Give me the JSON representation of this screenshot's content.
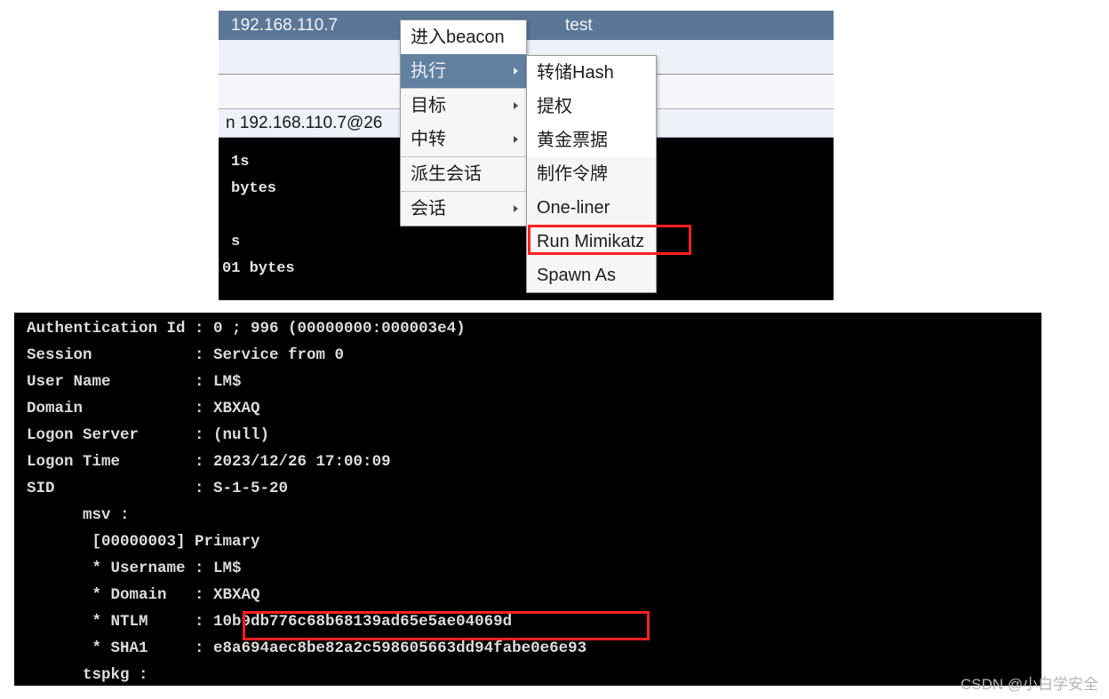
{
  "cs_panel": {
    "table_header": {
      "host": "192.168.110.7",
      "note": "test"
    },
    "console_line": "n 192.168.110.7@26",
    "background_lines": [
      "1s",
      "bytes",
      "s",
      "01 bytes"
    ]
  },
  "context_menu": {
    "items": [
      {
        "label": "进入beacon",
        "has_arrow": false,
        "selected": false,
        "separator_above": false,
        "white": true
      },
      {
        "label": "执行",
        "has_arrow": true,
        "selected": true,
        "separator_above": false,
        "white": false
      },
      {
        "label": "目标",
        "has_arrow": true,
        "selected": false,
        "separator_above": true,
        "white": false
      },
      {
        "label": "中转",
        "has_arrow": true,
        "selected": false,
        "separator_above": false,
        "white": false
      },
      {
        "label": "派生会话",
        "has_arrow": false,
        "selected": false,
        "separator_above": true,
        "white": false
      },
      {
        "label": "会话",
        "has_arrow": true,
        "selected": false,
        "separator_above": true,
        "white": false
      }
    ]
  },
  "sub_menu": {
    "items": [
      {
        "label": "转储Hash",
        "white": true
      },
      {
        "label": "提权",
        "white": true
      },
      {
        "label": "黄金票据",
        "white": true
      },
      {
        "label": "制作令牌",
        "white": false
      },
      {
        "label": "One-liner",
        "white": false
      },
      {
        "label": "Run Mimikatz",
        "white": false
      },
      {
        "label": "Spawn As",
        "white": false
      }
    ],
    "highlighted_item": "Run Mimikatz"
  },
  "highlight_color": "#ff2020",
  "accent_color": "#5a7796",
  "selected_item_color": "#6280a0",
  "terminal": {
    "lines": [
      "Authentication Id : 0 ; 996 (00000000:000003e4)",
      "Session           : Service from 0",
      "User Name         : LM$",
      "Domain            : XBXAQ",
      "Logon Server      : (null)",
      "Logon Time        : 2023/12/26 17:00:09",
      "SID               : S-1-5-20",
      "      msv :",
      "       [00000003] Primary",
      "       * Username : LM$",
      "       * Domain   : XBXAQ",
      "       * NTLM     : 10b9db776c68b68139ad65e5ae04069d",
      "       * SHA1     : e8a694aec8be82a2c598605663dd94fabe0e6e93",
      "      tspkg :"
    ],
    "fields": {
      "authentication_id": "0 ; 996 (00000000:000003e4)",
      "session": "Service from 0",
      "user_name": "LM$",
      "domain": "XBXAQ",
      "logon_server": "(null)",
      "logon_time": "2023/12/26 17:00:09",
      "sid": "S-1-5-20",
      "msv_primary": "[00000003] Primary",
      "msv_username": "LM$",
      "msv_domain": "XBXAQ",
      "msv_ntlm": "10b9db776c68b68139ad65e5ae04069d",
      "msv_sha1": "e8a694aec8be82a2c598605663dd94fabe0e6e93",
      "tspkg": "tspkg :"
    }
  },
  "watermark": "CSDN @小白学安全"
}
